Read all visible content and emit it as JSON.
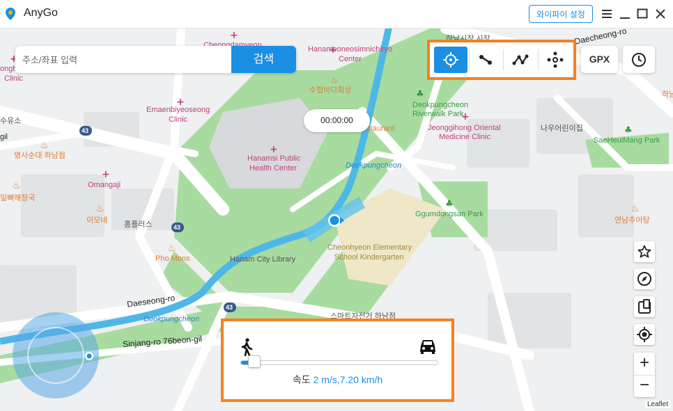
{
  "app": {
    "title": "AnyGo",
    "wifi_button": "와이파이 설정"
  },
  "search": {
    "placeholder": "주소/좌표 입력",
    "button": "검색"
  },
  "modes": [
    {
      "name": "teleport-mode-button",
      "icon": "crosshair-icon",
      "active": true
    },
    {
      "name": "two-spot-mode-button",
      "icon": "two-spot-route-icon",
      "active": false
    },
    {
      "name": "multi-spot-mode-button",
      "icon": "multi-spot-route-icon",
      "active": false
    },
    {
      "name": "joystick-mode-button",
      "icon": "joystick-icon",
      "active": false
    }
  ],
  "gpx_button": "GPX",
  "timer": "00:00:00",
  "speed": {
    "label": "속도",
    "value": "2 m/s,7.20 km/h",
    "fraction": 0.04
  },
  "attribution": "Leaflet",
  "colors": {
    "accent": "#1a8fe3",
    "highlight": "#f58024",
    "park": "#8fd18c",
    "water": "#4fb7e8"
  },
  "map_labels": {
    "cheongdam": "Cheongdamyeon",
    "hanameon": "Hanameoneosimnichiryo",
    "center": "Center",
    "hanam_market": "하남시장 시장",
    "daecheong": "Daecheong-ro",
    "sujeop": "수협바다회상",
    "deokpung_rw": "Deokpungcheon",
    "riverwalk": "Riverwalk Park",
    "emaen": "Emaenbiyeoseong",
    "clinic": "Clinic",
    "ongiki": "onghyun",
    "clinic2": "Clinic",
    "restaurant": "Restaurant",
    "jeonggihong": "Jeonggihong Oriental",
    "medicine": "Medicine Clinic",
    "nauiri": "나우어린이집",
    "saeheuimang": "SaeHeuiMang Park",
    "hanamsi": "Hanamsi Public",
    "health": "Health Center",
    "deokpung_mid": "Deokpungcheon",
    "myeongsa": "명사순대 하남점",
    "omangaji": "Omangaji",
    "ilppyeo": "일뼈해장국",
    "imone": "이모네",
    "homplus": "홈플러스",
    "phomons": "Pho Mons",
    "hanam_lib": "Hanam City Library",
    "ggumdong": "Ggumdongsan Park",
    "cheonhyeon": "Cheonhyeon Elementary",
    "kinder": "School Kindergarten",
    "yeonnam": "연남추어탕",
    "daeseong": "Daeseong-ro",
    "deokpung_low": "Deokpungcheon",
    "smartja": "스마트자전거 하남점",
    "sinjang": "Sinjang-ro 76beon-gil",
    "l43a": "43",
    "l43b": "43",
    "l43c": "43",
    "suyu": "수유소",
    "gil": "gil",
    "hanam_right": "하남"
  }
}
